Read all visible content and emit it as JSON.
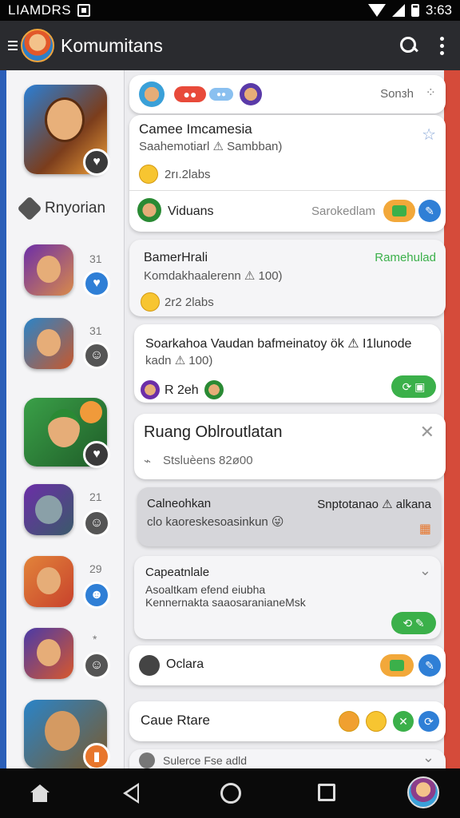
{
  "status_bar": {
    "carrier": "LIAMDRS",
    "time": "3:63"
  },
  "app_bar": {
    "title": "Komumitans",
    "icons": [
      "menu-icon",
      "avatar",
      "search-icon",
      "more-vert-icon"
    ]
  },
  "sidebar": {
    "heading": "Rnyorian",
    "counts": [
      "31",
      "31",
      "21",
      "29",
      "*"
    ],
    "colors": {
      "heart_badge": "#e8762c",
      "blue_badge": "#2f7fd6"
    }
  },
  "feed": {
    "header_card": {
      "search_label": "Sonзh"
    },
    "card1": {
      "title": "Camee Imcamesia",
      "subtitle": "Saahemotiarl ⚠ Sambban)",
      "stats": "2rı.2labs",
      "user": "Viduans",
      "action": "Sarokedlam"
    },
    "card2": {
      "title": "BamerHrali",
      "tag": "Ramehulad",
      "subtitle": "Komdakhaalerenn ⚠ 100)",
      "stats": "2r2 2labs"
    },
    "card3": {
      "line1": "Soarkahoa Vaudan bafmeinatoy ök ⚠ I1lunode",
      "line2": "kadn ⚠ 100)",
      "user": "R 2eh"
    },
    "card4": {
      "title": "Ruang Oblroutlatan",
      "meta": "Stsluèens 82ø00"
    },
    "card5": {
      "title": "Calneohkan",
      "right": "Snptotanao ⚠ alkana",
      "subtitle": "clo kaoreskesoasinkun 😜"
    },
    "card6": {
      "title": "Capeatnlale",
      "line1": "Asoaltkam efend eiubha",
      "line2": "Kennernakta saaosaranianeMsk"
    },
    "card7": {
      "title": "Oclara"
    },
    "card8": {
      "title": "Caue Rtare"
    },
    "card9": {
      "title": "Sulerce Fse adld"
    }
  },
  "colors": {
    "green": "#3bb04a",
    "blue": "#2f7fd6",
    "orange": "#e8762c",
    "accent_text": "#3bb04a"
  }
}
